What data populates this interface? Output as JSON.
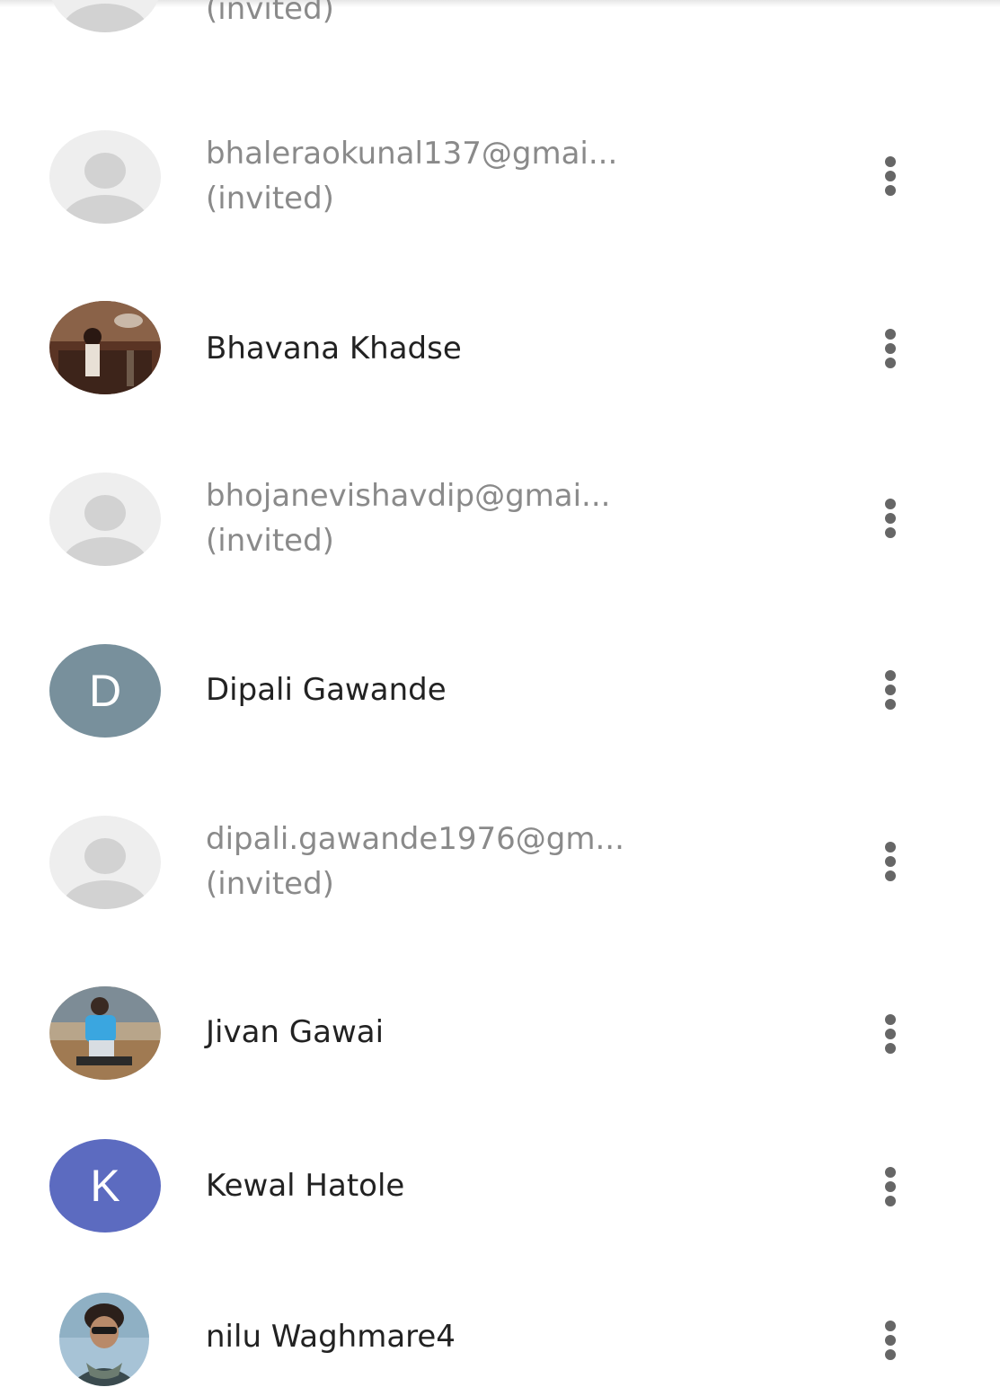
{
  "rows": [
    {
      "email": "",
      "status": "(invited)"
    },
    {
      "email": "bhaleraokunal137@gmai...",
      "status": "(invited)"
    },
    {
      "name": "Bhavana Khadse"
    },
    {
      "email": "bhojanevishavdip@gmai...",
      "status": "(invited)"
    },
    {
      "name": "Dipali Gawande",
      "letter": "D",
      "color": "#78909c"
    },
    {
      "email": "dipali.gawande1976@gm...",
      "status": "(invited)"
    },
    {
      "name": "Jivan Gawai"
    },
    {
      "name": "Kewal Hatole",
      "letter": "K",
      "color": "#5c6bc0"
    },
    {
      "name": "nilu Waghmare4"
    }
  ],
  "icons": {
    "placeholder": "person-placeholder-icon",
    "menu": "more-vert-icon"
  }
}
